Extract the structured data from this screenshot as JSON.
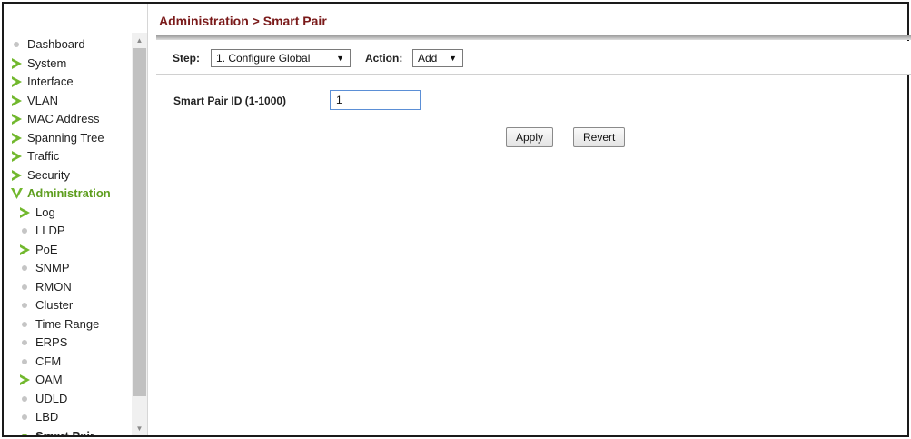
{
  "header": {
    "breadcrumb": "Administration > Smart Pair"
  },
  "sidebar": {
    "items": [
      {
        "label": "Dashboard",
        "icon": "dot-icon",
        "level": 0
      },
      {
        "label": "System",
        "icon": "arrow-right-icon",
        "level": 0
      },
      {
        "label": "Interface",
        "icon": "arrow-right-icon",
        "level": 0
      },
      {
        "label": "VLAN",
        "icon": "arrow-right-icon",
        "level": 0
      },
      {
        "label": "MAC Address",
        "icon": "arrow-right-icon",
        "level": 0
      },
      {
        "label": "Spanning Tree",
        "icon": "arrow-right-icon",
        "level": 0
      },
      {
        "label": "Traffic",
        "icon": "arrow-right-icon",
        "level": 0
      },
      {
        "label": "Security",
        "icon": "arrow-right-icon",
        "level": 0
      },
      {
        "label": "Administration",
        "icon": "chevron-down-icon",
        "level": 0,
        "state": "expanded"
      },
      {
        "label": "Log",
        "icon": "arrow-right-icon",
        "level": 1
      },
      {
        "label": "LLDP",
        "icon": "dot-icon",
        "level": 1
      },
      {
        "label": "PoE",
        "icon": "arrow-right-icon",
        "level": 1
      },
      {
        "label": "SNMP",
        "icon": "dot-icon",
        "level": 1
      },
      {
        "label": "RMON",
        "icon": "dot-icon",
        "level": 1
      },
      {
        "label": "Cluster",
        "icon": "dot-icon",
        "level": 1
      },
      {
        "label": "Time Range",
        "icon": "dot-icon",
        "level": 1
      },
      {
        "label": "ERPS",
        "icon": "dot-icon",
        "level": 1
      },
      {
        "label": "CFM",
        "icon": "dot-icon",
        "level": 1
      },
      {
        "label": "OAM",
        "icon": "arrow-right-icon",
        "level": 1
      },
      {
        "label": "UDLD",
        "icon": "dot-icon",
        "level": 1
      },
      {
        "label": "LBD",
        "icon": "dot-icon",
        "level": 1
      },
      {
        "label": "Smart Pair",
        "icon": "dot-icon",
        "level": 1,
        "state": "current"
      }
    ]
  },
  "toolbar": {
    "step_label": "Step:",
    "step_value": "1. Configure Global",
    "action_label": "Action:",
    "action_value": "Add"
  },
  "form": {
    "smart_pair_id_label": "Smart Pair ID (1-1000)",
    "smart_pair_id_value": "1"
  },
  "buttons": {
    "apply": "Apply",
    "revert": "Revert"
  },
  "colors": {
    "title": "#7a1a1a",
    "nav_arrow": "#72b82e",
    "nav_expanded": "#5e9e1f",
    "dot_inactive": "#c5c5c5",
    "dot_active": "#7bb53b",
    "input_border": "#5b8fd6"
  }
}
